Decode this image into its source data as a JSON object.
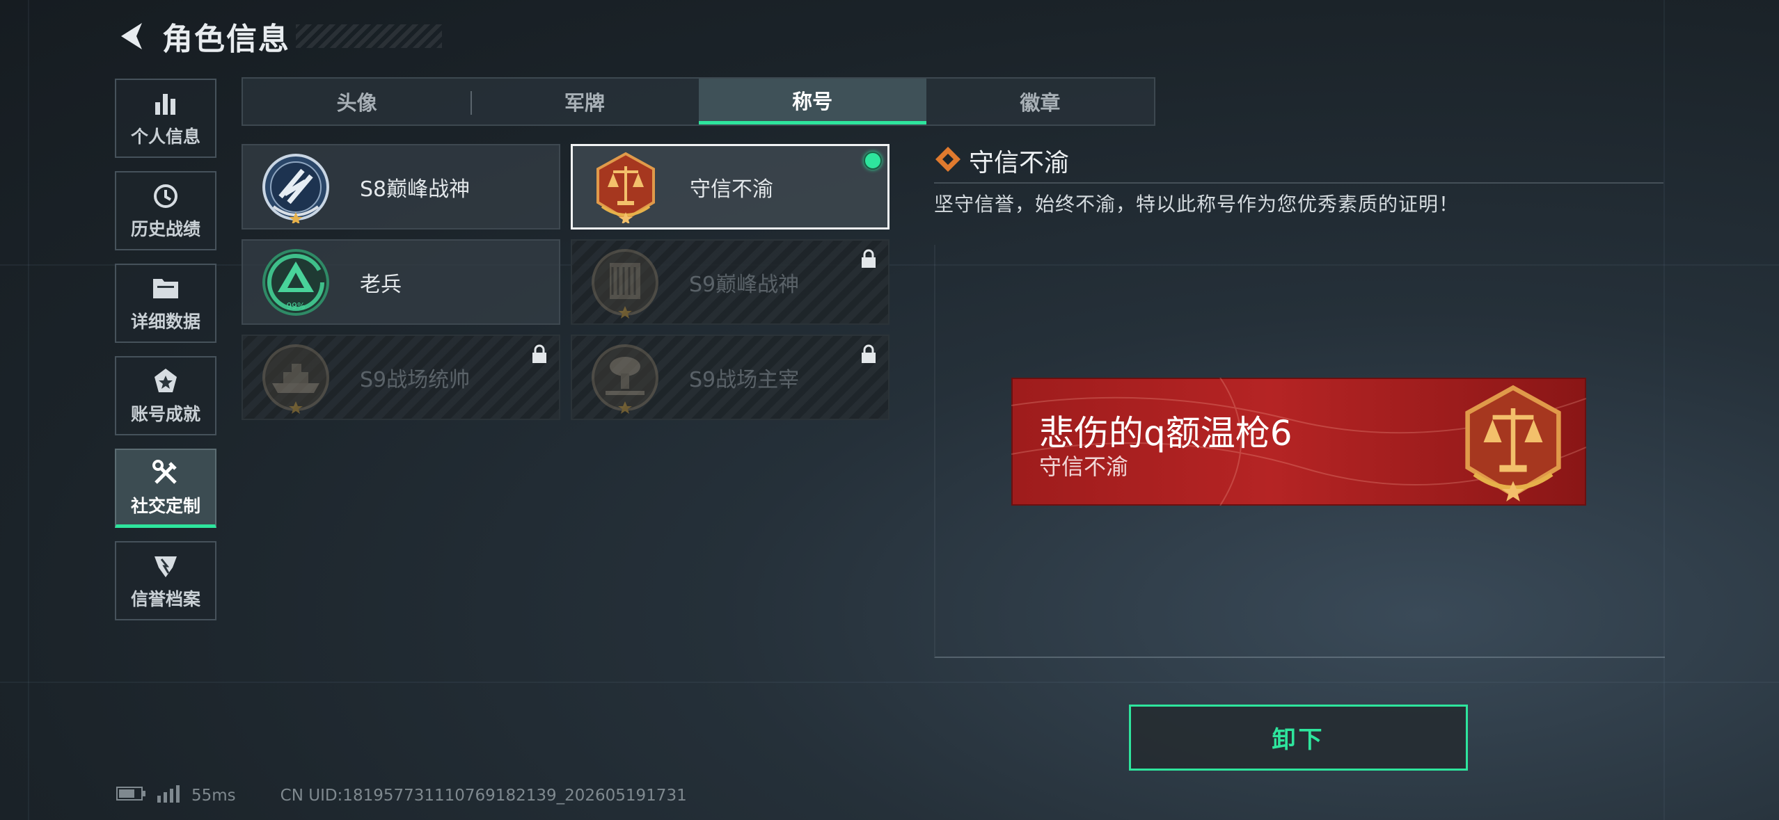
{
  "header": {
    "title": "角色信息"
  },
  "sidebar": {
    "items": [
      {
        "label": "个人信息",
        "icon": "bar-chart-icon"
      },
      {
        "label": "历史战绩",
        "icon": "history-icon"
      },
      {
        "label": "详细数据",
        "icon": "folder-icon"
      },
      {
        "label": "账号成就",
        "icon": "achievement-icon"
      },
      {
        "label": "社交定制",
        "icon": "tools-icon",
        "active": true
      },
      {
        "label": "信誉档案",
        "icon": "reputation-icon"
      }
    ]
  },
  "tabs": [
    {
      "label": "头像"
    },
    {
      "label": "军牌"
    },
    {
      "label": "称号",
      "active": true
    },
    {
      "label": "徽章"
    }
  ],
  "titles": [
    {
      "name": "S8巅峰战神",
      "locked": false,
      "selected": false
    },
    {
      "name": "守信不渝",
      "locked": false,
      "selected": true,
      "equipped": true
    },
    {
      "name": "老兵",
      "locked": false,
      "selected": false,
      "badge_text": "99%"
    },
    {
      "name": "S9巅峰战神",
      "locked": true,
      "selected": false
    },
    {
      "name": "S9战场统帅",
      "locked": true,
      "selected": false
    },
    {
      "name": "S9战场主宰",
      "locked": true,
      "selected": false
    }
  ],
  "detail": {
    "title": "守信不渝",
    "description": "坚守信誉，始终不渝，特以此称号作为您优秀素质的证明！"
  },
  "banner": {
    "player_name": "悲伤的q额温枪6",
    "title_text": "守信不渝"
  },
  "actions": {
    "unequip_label": "卸下"
  },
  "status": {
    "ping": "55ms",
    "uid": "CN UID:1819577311107691821​39_202605191731"
  },
  "colors": {
    "accent": "#2ee59d",
    "banner": "#b52424"
  }
}
